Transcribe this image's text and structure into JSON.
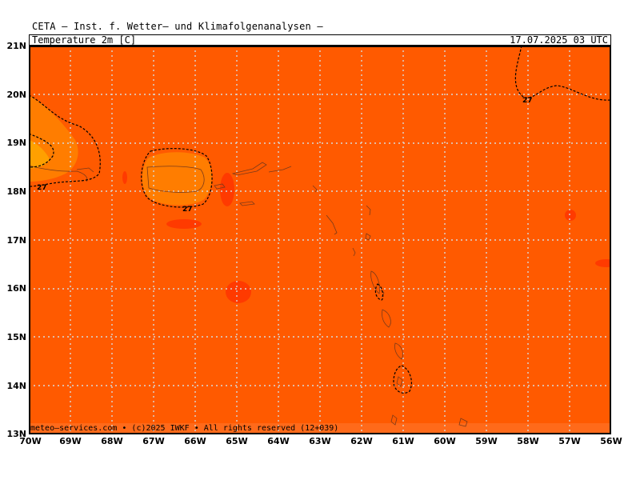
{
  "header": {
    "title": "CETA — Inst. f. Wetter— und Klimafolgenanalysen —",
    "variable": "Temperature_2m_[C]",
    "valid_time": "17.07.2025 03 UTC"
  },
  "footer": {
    "credit": "meteo—services.com • (c)2025 IWKF • All rights reserved (12+039)"
  },
  "map": {
    "lat_labels": [
      "21N",
      "20N",
      "19N",
      "18N",
      "17N",
      "16N",
      "15N",
      "14N",
      "13N"
    ],
    "lon_labels": [
      "70W",
      "69W",
      "68W",
      "67W",
      "66W",
      "65W",
      "64W",
      "63W",
      "62W",
      "61W",
      "60W",
      "59W",
      "58W",
      "57W",
      "56W"
    ],
    "extent": {
      "lon_min": -70,
      "lon_max": -56,
      "lat_min": 13,
      "lat_max": 21
    },
    "contour_labels": [
      "27",
      "27",
      "27"
    ],
    "colors": {
      "background_field": "#ff5a00",
      "warmer_field": "#ff7d00",
      "hot_spot": "#ff3a00",
      "footer_band": "#ff6a1a",
      "grid": "#d9d9d9",
      "contour": "#000000",
      "coastline": "#7a3a1a"
    }
  }
}
